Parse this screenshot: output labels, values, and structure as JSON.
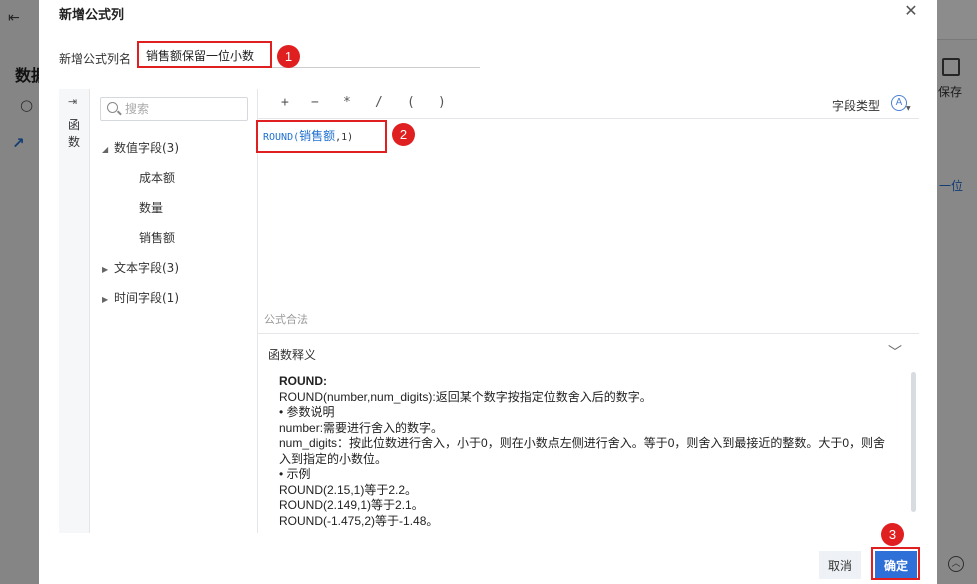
{
  "background": {
    "title_fragment": "数据",
    "save_label": "保存",
    "right_text": "一位",
    "trend_fragment": "i"
  },
  "dialog": {
    "title": "新增公式列",
    "name_label": "新增公式列名",
    "name_value": "销售额保留一位小数"
  },
  "annotations": [
    "1",
    "2",
    "3"
  ],
  "sidebar": {
    "rail_label": "函数",
    "search_placeholder": "搜索",
    "groups": [
      {
        "label": "数值字段(3)",
        "expanded": true,
        "children": [
          "成本额",
          "数量",
          "销售额"
        ]
      },
      {
        "label": "文本字段(3)",
        "expanded": false
      },
      {
        "label": "时间字段(1)",
        "expanded": false
      }
    ]
  },
  "toolbar": {
    "operators": [
      "+",
      "−",
      "*",
      "/",
      "(",
      ")"
    ],
    "field_type_label": "字段类型",
    "field_type_icon": "A"
  },
  "formula": {
    "prefix": "ROUND(",
    "field": "销售额",
    "suffix": ",1)"
  },
  "validation_text": "公式合法",
  "explanation": {
    "header": "函数释义",
    "fn_name": "ROUND:",
    "lines": [
      "ROUND(number,num_digits):返回某个数字按指定位数舍入后的数字。",
      "• 参数说明",
      "number:需要进行舍入的数字。",
      "num_digits：按此位数进行舍入，小于0，则在小数点左侧进行舍入。等于0，则舍入到最接近的整数。大于0，则舍",
      "入到指定的小数位。",
      "• 示例",
      "ROUND(2.15,1)等于2.2。",
      "ROUND(2.149,1)等于2.1。",
      "ROUND(-1.475,2)等于-1.48。"
    ]
  },
  "buttons": {
    "cancel": "取消",
    "ok": "确定"
  },
  "colors": {
    "accent": "#2f6fd8",
    "highlight": "#e02020",
    "formula_text": "#1f6fd0"
  }
}
